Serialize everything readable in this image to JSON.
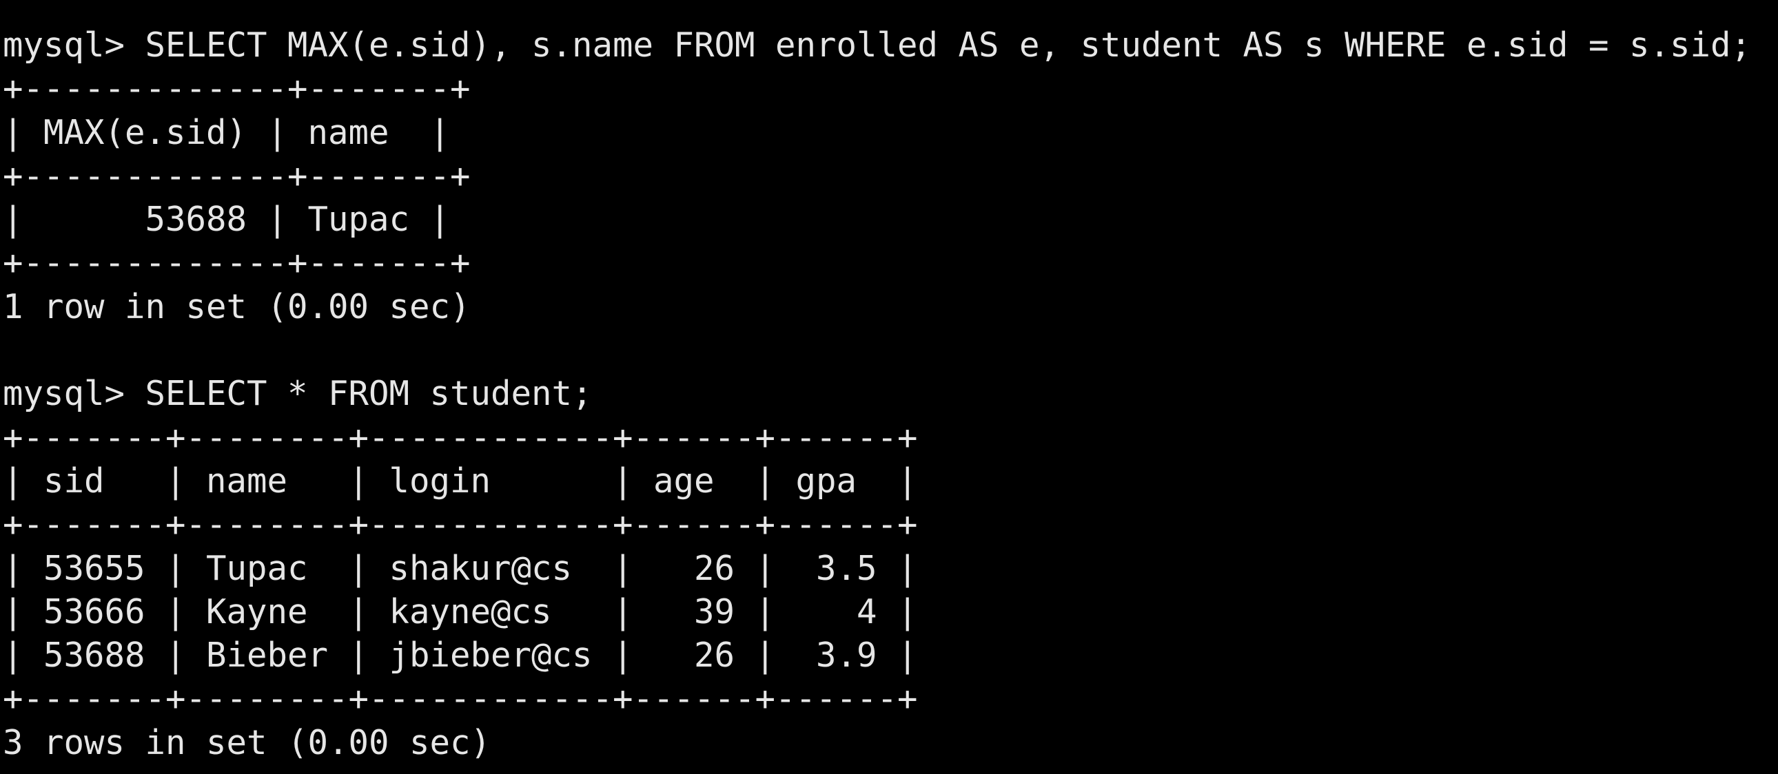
{
  "theme": {
    "background": "#000000",
    "foreground": "#e6e6e6"
  },
  "session": {
    "prompt": "mysql> ",
    "blocks": [
      {
        "query": "SELECT MAX(e.sid), s.name FROM enrolled AS e, student AS s WHERE e.sid = s.sid;",
        "table_border": "+-------------+-------+",
        "header_row": "| MAX(e.sid) | name  |",
        "rows": [
          "|      53688 | Tupac |"
        ],
        "status": "1 row in set (0.00 sec)"
      },
      {
        "query": "SELECT * FROM student;",
        "table_border": "+-------+--------+------------+------+------+",
        "header_row": "| sid   | name   | login      | age  | gpa  |",
        "rows": [
          "| 53655 | Tupac  | shakur@cs  |   26 |  3.5 |",
          "| 53666 | Kayne  | kayne@cs   |   39 |    4 |",
          "| 53688 | Bieber | jbieber@cs |   26 |  3.9 |"
        ],
        "status": "3 rows in set (0.00 sec)"
      }
    ]
  }
}
